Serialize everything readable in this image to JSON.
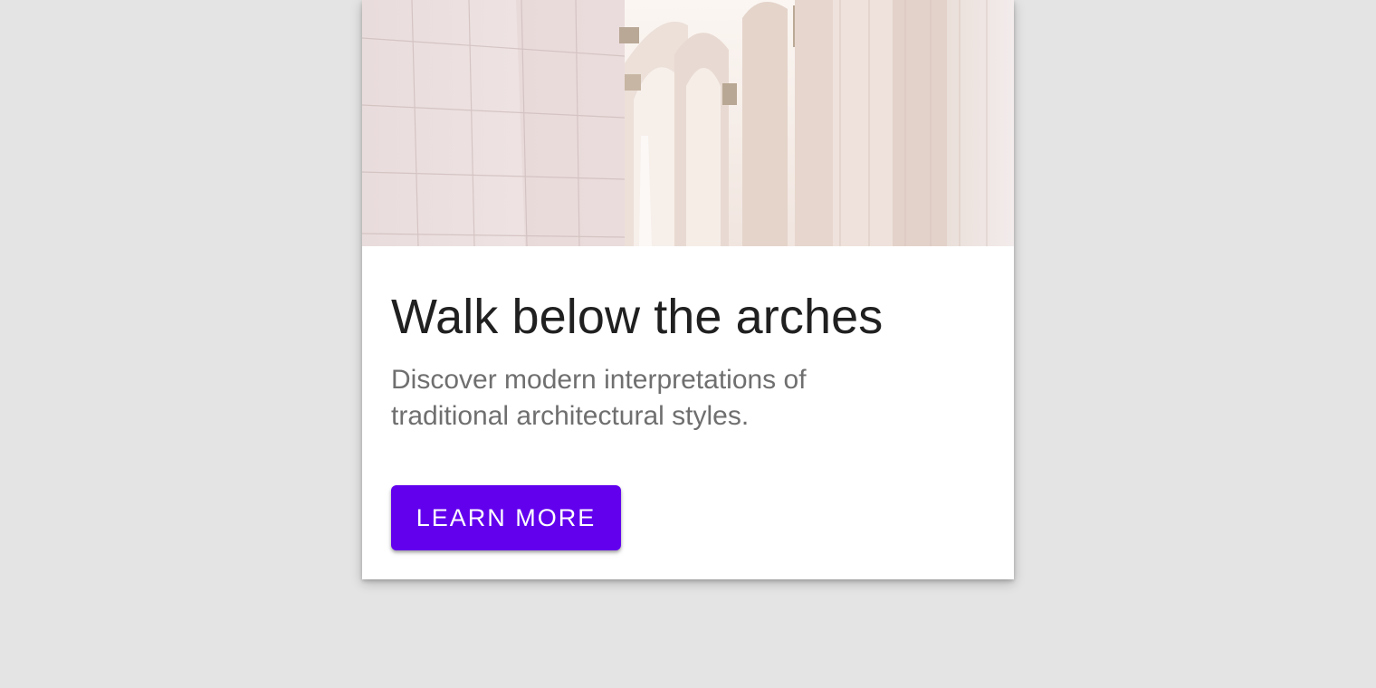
{
  "card": {
    "image_description": "arches-photo",
    "title": "Walk below the arches",
    "subtitle": "Discover modern interpretations of traditional architectural styles.",
    "button_label": "LEARN MORE"
  },
  "colors": {
    "background": "#e4e4e4",
    "card": "#ffffff",
    "accent": "#6200ee",
    "title_text": "#202020",
    "subtitle_text": "#6f6f6f"
  }
}
